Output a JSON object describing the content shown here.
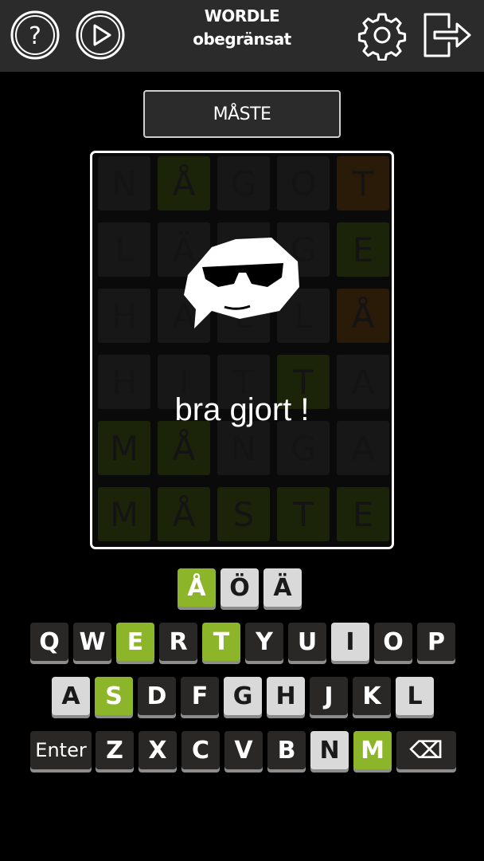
{
  "header": {
    "title_line1": "WORDLE",
    "title_line2": "obegränsat",
    "icons": [
      "help-icon",
      "play-icon",
      "gear-icon",
      "exit-icon"
    ]
  },
  "answer": "MÅSTE",
  "result_message": "bra gjort !",
  "colors": {
    "correct": "#8cb52a",
    "present": "#e07a1b",
    "absent": "#2a2727",
    "header_bg": "#2b2b2b"
  },
  "board": {
    "rows": [
      [
        {
          "l": "N",
          "s": "absent"
        },
        {
          "l": "Å",
          "s": "correct"
        },
        {
          "l": "G",
          "s": "absent"
        },
        {
          "l": "O",
          "s": "absent"
        },
        {
          "l": "T",
          "s": "present"
        }
      ],
      [
        {
          "l": "L",
          "s": "absent"
        },
        {
          "l": "Ä",
          "s": "absent"
        },
        {
          "l": "G",
          "s": "absent"
        },
        {
          "l": "G",
          "s": "absent"
        },
        {
          "l": "E",
          "s": "correct"
        }
      ],
      [
        {
          "l": "H",
          "s": "absent"
        },
        {
          "l": "A",
          "s": "absent"
        },
        {
          "l": "L",
          "s": "absent"
        },
        {
          "l": "L",
          "s": "absent"
        },
        {
          "l": "Å",
          "s": "present"
        }
      ],
      [
        {
          "l": "H",
          "s": "absent"
        },
        {
          "l": "I",
          "s": "absent"
        },
        {
          "l": "T",
          "s": "absent"
        },
        {
          "l": "T",
          "s": "correct"
        },
        {
          "l": "A",
          "s": "absent"
        }
      ],
      [
        {
          "l": "M",
          "s": "correct"
        },
        {
          "l": "Å",
          "s": "correct"
        },
        {
          "l": "N",
          "s": "absent"
        },
        {
          "l": "G",
          "s": "absent"
        },
        {
          "l": "A",
          "s": "absent"
        }
      ],
      [
        {
          "l": "M",
          "s": "correct"
        },
        {
          "l": "Å",
          "s": "correct"
        },
        {
          "l": "S",
          "s": "correct"
        },
        {
          "l": "T",
          "s": "correct"
        },
        {
          "l": "E",
          "s": "correct"
        }
      ]
    ]
  },
  "keyboard": {
    "row0": [
      {
        "k": "Å",
        "s": "green"
      },
      {
        "k": "Ö",
        "s": "light"
      },
      {
        "k": "Ä",
        "s": "light"
      }
    ],
    "row1": [
      {
        "k": "Q",
        "s": "dark"
      },
      {
        "k": "W",
        "s": "dark"
      },
      {
        "k": "E",
        "s": "green"
      },
      {
        "k": "R",
        "s": "dark"
      },
      {
        "k": "T",
        "s": "green"
      },
      {
        "k": "Y",
        "s": "dark"
      },
      {
        "k": "U",
        "s": "dark"
      },
      {
        "k": "I",
        "s": "light"
      },
      {
        "k": "O",
        "s": "dark"
      },
      {
        "k": "P",
        "s": "dark"
      }
    ],
    "row2": [
      {
        "k": "A",
        "s": "light"
      },
      {
        "k": "S",
        "s": "green"
      },
      {
        "k": "D",
        "s": "dark"
      },
      {
        "k": "F",
        "s": "dark"
      },
      {
        "k": "G",
        "s": "light"
      },
      {
        "k": "H",
        "s": "light"
      },
      {
        "k": "J",
        "s": "dark"
      },
      {
        "k": "K",
        "s": "dark"
      },
      {
        "k": "L",
        "s": "light"
      }
    ],
    "row3": [
      {
        "k": "Enter",
        "s": "dark"
      },
      {
        "k": "Z",
        "s": "dark"
      },
      {
        "k": "X",
        "s": "dark"
      },
      {
        "k": "C",
        "s": "dark"
      },
      {
        "k": "V",
        "s": "dark"
      },
      {
        "k": "B",
        "s": "dark"
      },
      {
        "k": "N",
        "s": "light"
      },
      {
        "k": "M",
        "s": "green"
      },
      {
        "k": "⌫",
        "s": "dark"
      }
    ]
  }
}
